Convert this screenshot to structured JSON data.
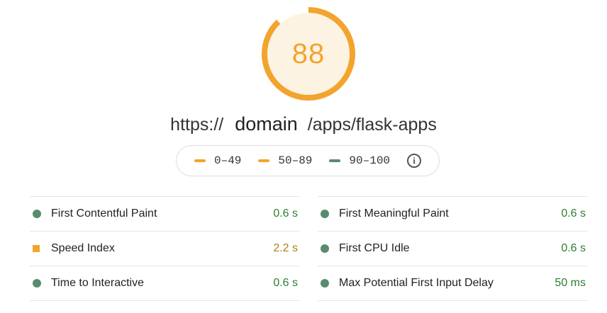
{
  "score": {
    "value": "88",
    "fraction": 0.88,
    "color": "#f2a42d",
    "track_color": "#fdf3e3"
  },
  "url": {
    "prefix": "https://",
    "domain": "domain",
    "path": "/apps/flask-apps"
  },
  "legend": {
    "items": [
      {
        "label": "0–49",
        "color": "#f2a42d"
      },
      {
        "label": "50–89",
        "color": "#f2a42d"
      },
      {
        "label": "90–100",
        "color": "#5b8a6e"
      }
    ],
    "info_icon": "info-icon"
  },
  "metrics": {
    "left": [
      {
        "name": "First Contentful Paint",
        "value": "0.6 s",
        "status": "pass"
      },
      {
        "name": "Speed Index",
        "value": "2.2 s",
        "status": "average"
      },
      {
        "name": "Time to Interactive",
        "value": "0.6 s",
        "status": "pass"
      }
    ],
    "right": [
      {
        "name": "First Meaningful Paint",
        "value": "0.6 s",
        "status": "pass"
      },
      {
        "name": "First CPU Idle",
        "value": "0.6 s",
        "status": "pass"
      },
      {
        "name": "Max Potential First Input Delay",
        "value": "50 ms",
        "status": "pass"
      }
    ]
  },
  "colors": {
    "pass": "#5b8a6e",
    "average": "#f2a42d"
  }
}
